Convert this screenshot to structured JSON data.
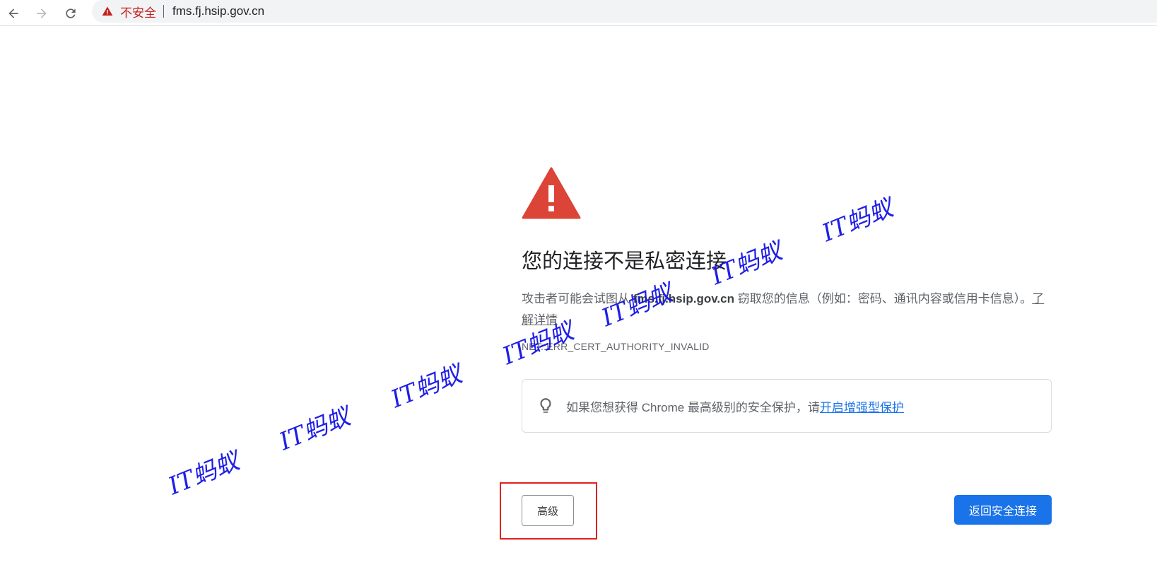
{
  "browser": {
    "security_label": "不安全",
    "url": "fms.fj.hsip.gov.cn"
  },
  "interstitial": {
    "heading": "您的连接不是私密连接",
    "desc_prefix": "攻击者可能会试图从 ",
    "desc_domain": "fms.fj.hsip.gov.cn",
    "desc_suffix": " 窃取您的信息（例如：密码、通讯内容或信用卡信息）。",
    "learn_more": "了解详情",
    "error_code": "NET::ERR_CERT_AUTHORITY_INVALID",
    "enhanced_text": "如果您想获得 Chrome 最高级别的安全保护，请",
    "enhanced_link": "开启增强型保护",
    "advanced_button": "高级",
    "back_button": "返回安全连接"
  },
  "watermark_text": "IT蚂蚁",
  "colors": {
    "primary_blue": "#1a73e8",
    "warning_red": "#db4437",
    "not_secure_red": "#c5221f",
    "watermark_blue": "#1414e6",
    "highlight_red": "#e0201f"
  },
  "icons": [
    "back-arrow-icon",
    "forward-arrow-icon",
    "reload-icon",
    "warning-triangle-icon",
    "lightbulb-icon"
  ]
}
